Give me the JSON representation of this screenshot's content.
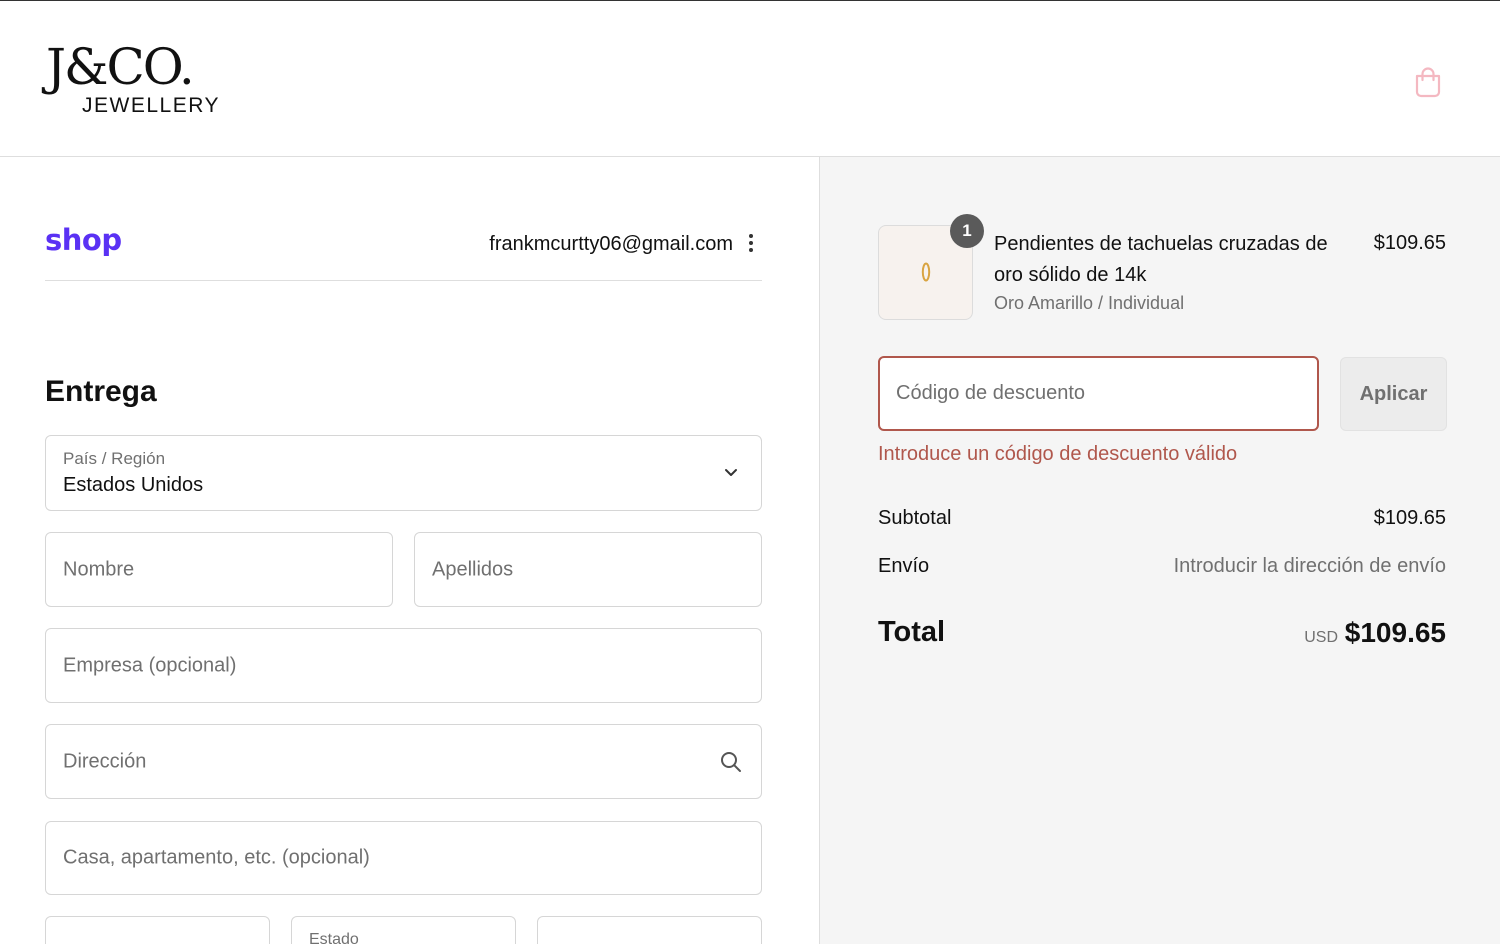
{
  "header": {
    "logo_main": "J&CO.",
    "logo_sub": "JEWELLERY",
    "cart_icon": "shopping-bag-icon",
    "cart_color": "#f4b8c1"
  },
  "shop": {
    "logo": "shop",
    "brand_color": "#5a31f4",
    "email": "frankmcurtty06@gmail.com",
    "menu_icon": "kebab-menu-icon"
  },
  "delivery": {
    "title": "Entrega",
    "country_label": "País / Región",
    "country_value": "Estados Unidos",
    "first_name_placeholder": "Nombre",
    "last_name_placeholder": "Apellidos",
    "company_placeholder": "Empresa (opcional)",
    "address_placeholder": "Dirección",
    "apartment_placeholder": "Casa, apartamento, etc. (opcional)",
    "state_label": "Estado"
  },
  "summary": {
    "item": {
      "quantity": "1",
      "name": "Pendientes de tachuelas cruzadas de oro sólido de 14k",
      "variant": "Oro Amarillo / Individual",
      "price": "$109.65"
    },
    "discount_placeholder": "Código de descuento",
    "apply_label": "Aplicar",
    "error": "Introduce un código de descuento válido",
    "error_color": "#b0574c",
    "subtotal_label": "Subtotal",
    "subtotal_value": "$109.65",
    "shipping_label": "Envío",
    "shipping_value": "Introducir la dirección de envío",
    "total_label": "Total",
    "currency": "USD",
    "total_value": "$109.65"
  }
}
